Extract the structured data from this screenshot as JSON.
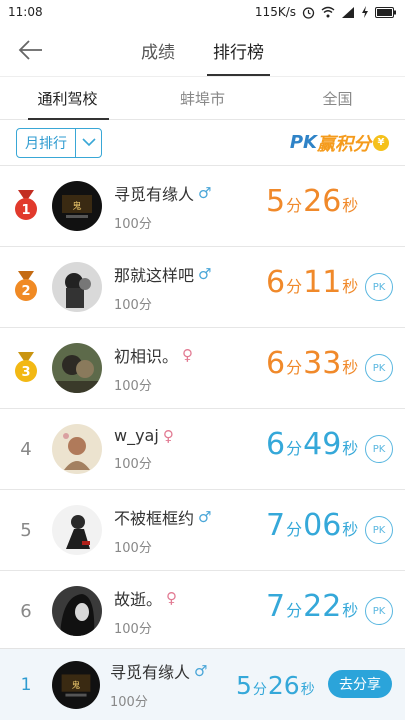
{
  "status_bar": {
    "time": "11:08",
    "speed": "115K/s",
    "icons": [
      "alarm-icon",
      "wifi-icon",
      "signal-icon",
      "charging-icon",
      "battery-icon"
    ]
  },
  "nav": {
    "back_icon": "arrow-left-icon",
    "tabs": [
      {
        "label": "成绩",
        "active": false
      },
      {
        "label": "排行榜",
        "active": true
      }
    ]
  },
  "sub_tabs": [
    {
      "label": "通利驾校",
      "active": true
    },
    {
      "label": "蚌埠市",
      "active": false
    },
    {
      "label": "全国",
      "active": false
    }
  ],
  "filter": {
    "select_value": "月排行",
    "logo_text_pk": "PK",
    "logo_text_rest": "赢积分",
    "logo_coin": "¥"
  },
  "ranking": [
    {
      "rank": "1",
      "medal": "red",
      "name": "寻觅有缘人",
      "gender": "♂",
      "score": "100分",
      "min": "5",
      "min_unit": "分",
      "sec": "26",
      "sec_unit": "秒",
      "color": "orange",
      "pk": ""
    },
    {
      "rank": "2",
      "medal": "orange",
      "name": "那就这样吧",
      "gender": "♂",
      "score": "100分",
      "min": "6",
      "min_unit": "分",
      "sec": "11",
      "sec_unit": "秒",
      "color": "orange",
      "pk": "PK"
    },
    {
      "rank": "3",
      "medal": "gold",
      "name": "初相识。",
      "gender": "♀",
      "score": "100分",
      "min": "6",
      "min_unit": "分",
      "sec": "33",
      "sec_unit": "秒",
      "color": "orange",
      "pk": "PK"
    },
    {
      "rank": "4",
      "medal": "",
      "name": "w_yaj",
      "gender": "♀",
      "score": "100分",
      "min": "6",
      "min_unit": "分",
      "sec": "49",
      "sec_unit": "秒",
      "color": "blue",
      "pk": "PK"
    },
    {
      "rank": "5",
      "medal": "",
      "name": "不被框框约",
      "gender": "♂",
      "score": "100分",
      "min": "7",
      "min_unit": "分",
      "sec": "06",
      "sec_unit": "秒",
      "color": "blue",
      "pk": "PK"
    },
    {
      "rank": "6",
      "medal": "",
      "name": "故逝。",
      "gender": "♀",
      "score": "100分",
      "min": "7",
      "min_unit": "分",
      "sec": "22",
      "sec_unit": "秒",
      "color": "blue",
      "pk": "PK"
    }
  ],
  "my_rank": {
    "rank": "1",
    "name": "寻觅有缘人",
    "gender": "♂",
    "score": "100分",
    "min": "5",
    "min_unit": "分",
    "sec": "26",
    "sec_unit": "秒",
    "share_label": "去分享"
  },
  "colors": {
    "accent_blue": "#35a8d9",
    "time_orange": "#f0892a",
    "medal_red": "#e13a2c",
    "medal_orange": "#f08a24",
    "medal_gold": "#f2b814"
  }
}
